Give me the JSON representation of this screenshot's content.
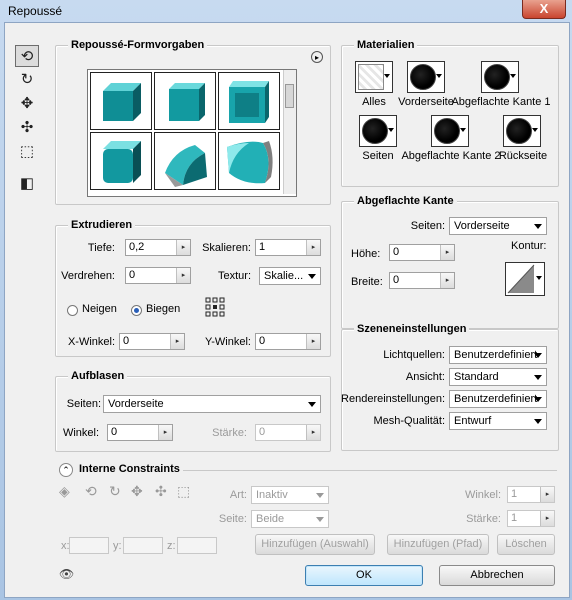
{
  "window": {
    "title": "Repoussé",
    "close_glyph": "X"
  },
  "tools": [
    "rotate-object-icon",
    "roll-object-icon",
    "drag-object-icon",
    "slide-object-icon",
    "scale-object-icon",
    "camera-icon"
  ],
  "presets": {
    "title": "Repoussé-Formvorgaben",
    "menu_glyph": "▸"
  },
  "extrude": {
    "title": "Extrudieren",
    "depth_label": "Tiefe:",
    "depth_value": "0,2",
    "scale_label": "Skalieren:",
    "scale_value": "1",
    "twist_label": "Verdrehen:",
    "twist_value": "0",
    "texture_label": "Textur:",
    "texture_value": "Skalie...",
    "radio_neigen": "Neigen",
    "radio_biegen": "Biegen",
    "selected_mode": "Biegen",
    "xangle_label": "X-Winkel:",
    "xangle_value": "0",
    "yangle_label": "Y-Winkel:",
    "yangle_value": "0"
  },
  "inflate": {
    "title": "Aufblasen",
    "sides_label": "Seiten:",
    "sides_value": "Vorderseite",
    "angle_label": "Winkel:",
    "angle_value": "0",
    "strength_label": "Stärke:",
    "strength_value": "0"
  },
  "materials": {
    "title": "Materialien",
    "items": [
      "Alles",
      "Vorderseite",
      "Abgeflachte Kante 1",
      "Seiten",
      "Abgeflachte Kante 2",
      "Rückseite"
    ]
  },
  "bevel": {
    "title": "Abgeflachte Kante",
    "sides_label": "Seiten:",
    "sides_value": "Vorderseite",
    "height_label": "Höhe:",
    "height_value": "0",
    "contour_label": "Kontur:",
    "width_label": "Breite:",
    "width_value": "0"
  },
  "scene": {
    "title": "Szeneneinstellungen",
    "lights_label": "Lichtquellen:",
    "lights_value": "Benutzerdefiniert",
    "view_label": "Ansicht:",
    "view_value": "Standard",
    "render_label": "Rendereinstellungen:",
    "render_value": "Benutzerdefiniert",
    "mesh_label": "Mesh-Qualität:",
    "mesh_value": "Entwurf"
  },
  "constraints": {
    "title": "Interne Constraints",
    "art_label": "Art:",
    "art_value": "Inaktiv",
    "side_label": "Seite:",
    "side_value": "Beide",
    "angle_label": "Winkel:",
    "angle_value": "1",
    "strength_label": "Stärke:",
    "strength_value": "1",
    "x_label": "x:",
    "y_label": "y:",
    "z_label": "z:",
    "add_selection": "Hinzufügen (Auswahl)",
    "add_path": "Hinzufügen (Pfad)",
    "delete": "Löschen"
  },
  "buttons": {
    "ok": "OK",
    "cancel": "Abbrechen"
  }
}
